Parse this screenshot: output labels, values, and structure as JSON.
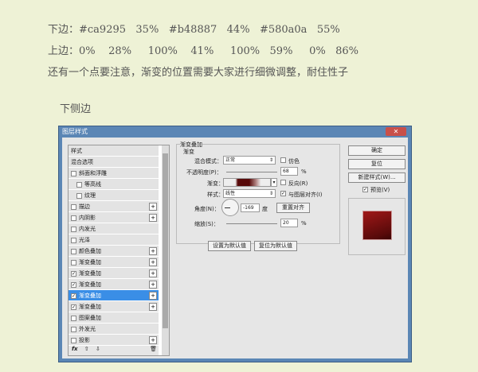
{
  "text": {
    "line1": "下边：#ca9295   35%   #b48887   44%   #580a0a   55%",
    "line2": "上边：0%    28%     100%    41%     100%   59%     0%   86%",
    "line3": "还有一个点要注意，渐变的位置需要大家进行细微调整，耐住性子",
    "line4": "下侧边"
  },
  "dialog": {
    "title": "图层样式",
    "close": "✕",
    "list": [
      {
        "label": "样式",
        "cb": null,
        "plus": false
      },
      {
        "label": "混合选项",
        "cb": null,
        "plus": false
      },
      {
        "label": "斜面和浮雕",
        "cb": false,
        "plus": false
      },
      {
        "label": "等高线",
        "cb": false,
        "plus": false,
        "indent": true
      },
      {
        "label": "纹理",
        "cb": false,
        "plus": false,
        "indent": true
      },
      {
        "label": "描边",
        "cb": false,
        "plus": true
      },
      {
        "label": "内阴影",
        "cb": false,
        "plus": true
      },
      {
        "label": "内发光",
        "cb": false,
        "plus": false
      },
      {
        "label": "光泽",
        "cb": false,
        "plus": false
      },
      {
        "label": "颜色叠加",
        "cb": false,
        "plus": true
      },
      {
        "label": "渐变叠加",
        "cb": false,
        "plus": true
      },
      {
        "label": "渐变叠加",
        "cb": true,
        "plus": true
      },
      {
        "label": "渐变叠加",
        "cb": true,
        "plus": true
      },
      {
        "label": "渐变叠加",
        "cb": true,
        "plus": true,
        "selected": true
      },
      {
        "label": "渐变叠加",
        "cb": true,
        "plus": true
      },
      {
        "label": "图案叠加",
        "cb": false,
        "plus": false
      },
      {
        "label": "外发光",
        "cb": false,
        "plus": false
      },
      {
        "label": "投影",
        "cb": false,
        "plus": true
      }
    ],
    "footer": {
      "fx": "fx",
      "up": "⇧",
      "down": "⇩",
      "trash": "🗑"
    },
    "panel": {
      "group_title": "渐变叠加",
      "sub_title": "渐变",
      "blend_label": "混合模式：",
      "blend_value": "正常",
      "dither_label": "仿色",
      "opacity_label": "不透明度(P)：",
      "opacity_value": "68",
      "opacity_unit": "%",
      "gradient_label": "渐变：",
      "reverse_label": "反向(R)",
      "style_label": "样式：",
      "style_value": "线性",
      "align_label": "与图层对齐(I)",
      "angle_label": "角度(N)：",
      "angle_value": "-169",
      "angle_unit": "度",
      "reset_align": "重置对齐",
      "scale_label": "缩放(S)：",
      "scale_value": "20",
      "scale_unit": "%",
      "set_default": "设置为默认值",
      "reset_default": "复位为默认值"
    },
    "buttons": {
      "ok": "确定",
      "reset": "复位",
      "new_style": "新建样式(W)...",
      "preview": "预览(V)"
    },
    "colors": {
      "gradient": [
        "#ca9295",
        "#b48887",
        "#580a0a"
      ],
      "preview": "#8a1010"
    }
  }
}
